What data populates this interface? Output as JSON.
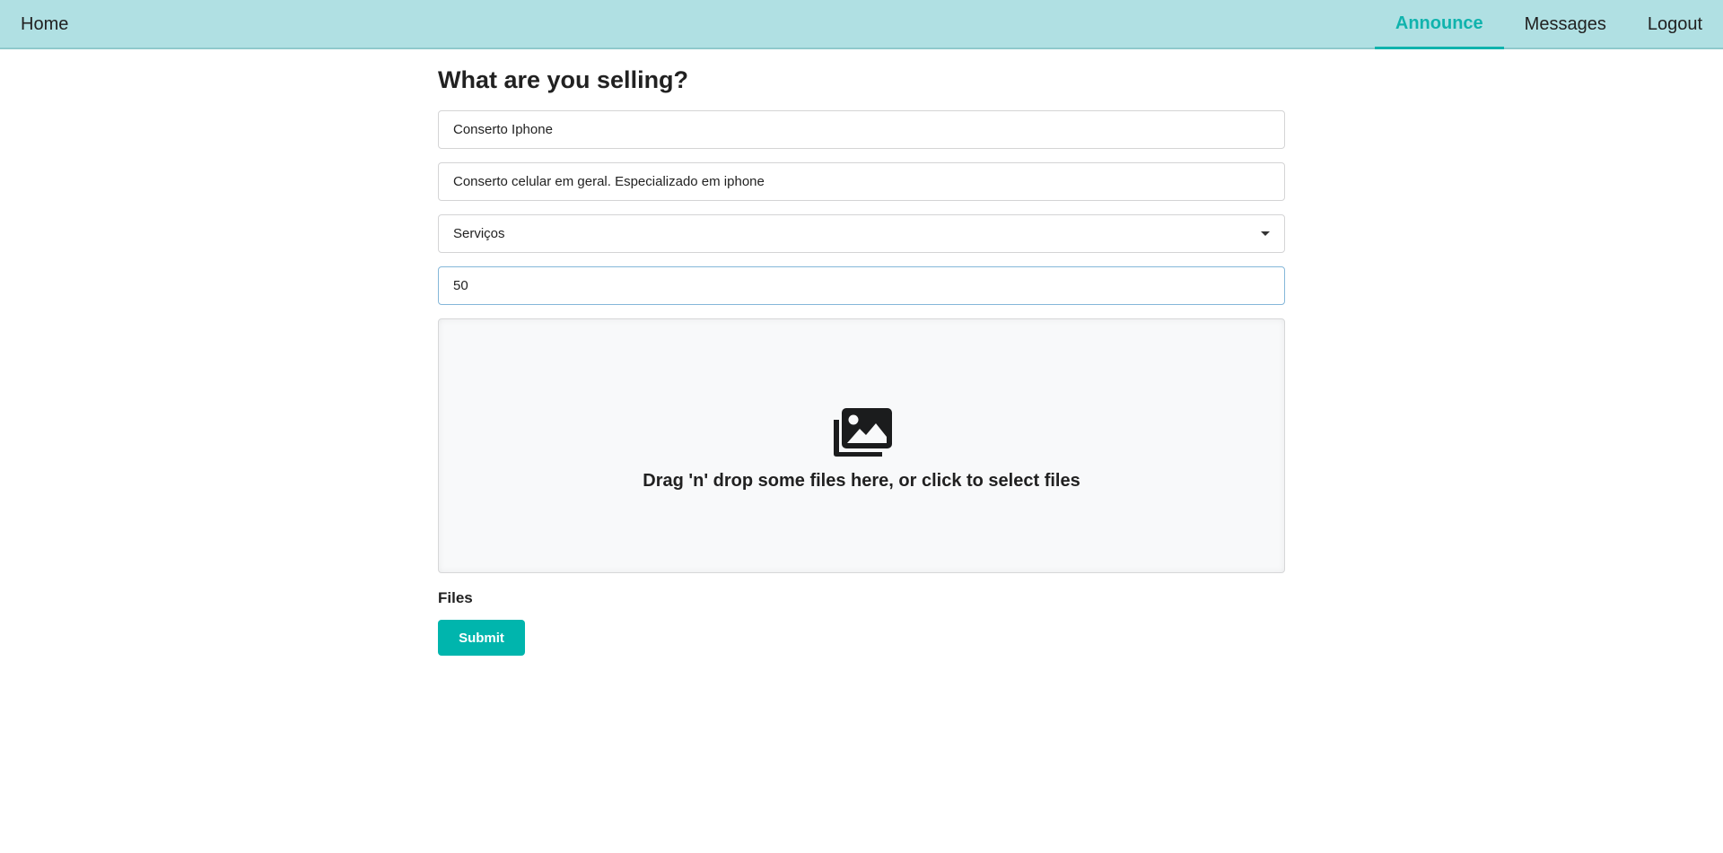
{
  "nav": {
    "home": "Home",
    "announce": "Announce",
    "messages": "Messages",
    "logout": "Logout"
  },
  "form": {
    "title": "What are you selling?",
    "name_value": "Conserto Iphone",
    "description_value": "Conserto celular em geral. Especializado em iphone",
    "category_value": "Serviços",
    "price_value": "50",
    "dropzone_text": "Drag 'n' drop some files here, or click to select files",
    "dropzone_icon": "images-icon",
    "files_label": "Files",
    "submit_label": "Submit"
  },
  "colors": {
    "navbar_bg": "#b0e0e3",
    "accent": "#00b5ad"
  }
}
